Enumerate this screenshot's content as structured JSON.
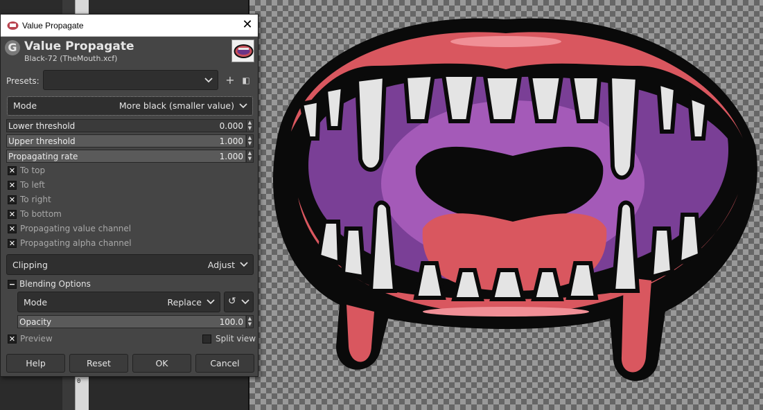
{
  "dialog": {
    "window_title": "Value Propagate",
    "header_title": "Value Propagate",
    "header_subtitle": "Black-72 (TheMouth.xcf)",
    "presets_label": "Presets:",
    "presets_value": "",
    "mode_label": "Mode",
    "mode_value": "More black (smaller value)",
    "sliders": [
      {
        "label": "Lower threshold",
        "value": "0.000",
        "fraction": 0.0
      },
      {
        "label": "Upper threshold",
        "value": "1.000",
        "fraction": 1.0
      },
      {
        "label": "Propagating rate",
        "value": "1.000",
        "fraction": 1.0
      }
    ],
    "checkboxes": [
      {
        "label": "To top",
        "checked": true
      },
      {
        "label": "To left",
        "checked": true
      },
      {
        "label": "To right",
        "checked": true
      },
      {
        "label": "To bottom",
        "checked": true
      },
      {
        "label": "Propagating value channel",
        "checked": true
      },
      {
        "label": "Propagating alpha channel",
        "checked": true
      }
    ],
    "clipping_label": "Clipping",
    "clipping_value": "Adjust",
    "blending_label": "Blending Options",
    "blend_mode_label": "Mode",
    "blend_mode_value": "Replace",
    "opacity_label": "Opacity",
    "opacity_value": "100.0",
    "opacity_fraction": 1.0,
    "preview_label": "Preview",
    "preview_checked": true,
    "split_view_label": "Split view",
    "split_view_checked": false,
    "buttons": {
      "help": "Help",
      "reset": "Reset",
      "ok": "OK",
      "cancel": "Cancel"
    }
  },
  "ruler": {
    "label": "0"
  },
  "colors": {
    "lip": "#d9575f",
    "lip_dark": "#b84550",
    "mouth_inner": "#7a3f96",
    "mouth_inner_light": "#a45ab8",
    "tooth": "#e4e4e4",
    "outline": "#0a0a0a"
  }
}
